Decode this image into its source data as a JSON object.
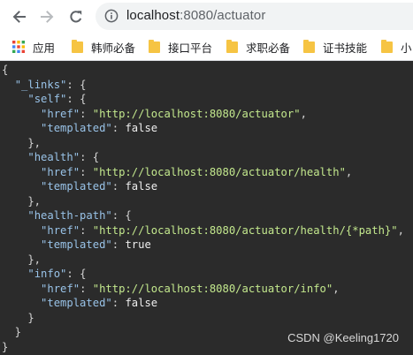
{
  "browser": {
    "url_host": "localhost",
    "url_rest": ":8080/actuator",
    "icons": [
      "back-arrow-icon",
      "forward-arrow-icon",
      "reload-icon",
      "info-icon"
    ]
  },
  "bookmarks": [
    {
      "label": "应用",
      "icon": "apps-grid-icon"
    },
    {
      "label": "韩师必备",
      "icon": "folder-icon"
    },
    {
      "label": "接口平台",
      "icon": "folder-icon"
    },
    {
      "label": "求职必备",
      "icon": "folder-icon"
    },
    {
      "label": "证书技能",
      "icon": "folder-icon"
    },
    {
      "label": "小",
      "icon": "folder-icon"
    }
  ],
  "json_view": {
    "lines": [
      [
        {
          "t": "punc",
          "v": "{"
        }
      ],
      [
        {
          "t": "punc",
          "v": "  "
        },
        {
          "t": "key",
          "v": "\"_links\""
        },
        {
          "t": "punc",
          "v": ": {"
        }
      ],
      [
        {
          "t": "punc",
          "v": "    "
        },
        {
          "t": "key",
          "v": "\"self\""
        },
        {
          "t": "punc",
          "v": ": {"
        }
      ],
      [
        {
          "t": "punc",
          "v": "      "
        },
        {
          "t": "key",
          "v": "\"href\""
        },
        {
          "t": "punc",
          "v": ": "
        },
        {
          "t": "str",
          "v": "\"http://localhost:8080/actuator\""
        },
        {
          "t": "punc",
          "v": ","
        }
      ],
      [
        {
          "t": "punc",
          "v": "      "
        },
        {
          "t": "key",
          "v": "\"templated\""
        },
        {
          "t": "punc",
          "v": ": "
        },
        {
          "t": "lit",
          "v": "false"
        }
      ],
      [
        {
          "t": "punc",
          "v": "    },"
        }
      ],
      [
        {
          "t": "punc",
          "v": "    "
        },
        {
          "t": "key",
          "v": "\"health\""
        },
        {
          "t": "punc",
          "v": ": {"
        }
      ],
      [
        {
          "t": "punc",
          "v": "      "
        },
        {
          "t": "key",
          "v": "\"href\""
        },
        {
          "t": "punc",
          "v": ": "
        },
        {
          "t": "str",
          "v": "\"http://localhost:8080/actuator/health\""
        },
        {
          "t": "punc",
          "v": ","
        }
      ],
      [
        {
          "t": "punc",
          "v": "      "
        },
        {
          "t": "key",
          "v": "\"templated\""
        },
        {
          "t": "punc",
          "v": ": "
        },
        {
          "t": "lit",
          "v": "false"
        }
      ],
      [
        {
          "t": "punc",
          "v": "    },"
        }
      ],
      [
        {
          "t": "punc",
          "v": "    "
        },
        {
          "t": "key",
          "v": "\"health-path\""
        },
        {
          "t": "punc",
          "v": ": {"
        }
      ],
      [
        {
          "t": "punc",
          "v": "      "
        },
        {
          "t": "key",
          "v": "\"href\""
        },
        {
          "t": "punc",
          "v": ": "
        },
        {
          "t": "str",
          "v": "\"http://localhost:8080/actuator/health/{*path}\""
        },
        {
          "t": "punc",
          "v": ","
        }
      ],
      [
        {
          "t": "punc",
          "v": "      "
        },
        {
          "t": "key",
          "v": "\"templated\""
        },
        {
          "t": "punc",
          "v": ": "
        },
        {
          "t": "lit",
          "v": "true"
        }
      ],
      [
        {
          "t": "punc",
          "v": "    },"
        }
      ],
      [
        {
          "t": "punc",
          "v": "    "
        },
        {
          "t": "key",
          "v": "\"info\""
        },
        {
          "t": "punc",
          "v": ": {"
        }
      ],
      [
        {
          "t": "punc",
          "v": "      "
        },
        {
          "t": "key",
          "v": "\"href\""
        },
        {
          "t": "punc",
          "v": ": "
        },
        {
          "t": "str",
          "v": "\"http://localhost:8080/actuator/info\""
        },
        {
          "t": "punc",
          "v": ","
        }
      ],
      [
        {
          "t": "punc",
          "v": "      "
        },
        {
          "t": "key",
          "v": "\"templated\""
        },
        {
          "t": "punc",
          "v": ": "
        },
        {
          "t": "lit",
          "v": "false"
        }
      ],
      [
        {
          "t": "punc",
          "v": "    }"
        }
      ],
      [
        {
          "t": "punc",
          "v": "  }"
        }
      ],
      [
        {
          "t": "punc",
          "v": "}"
        }
      ]
    ]
  },
  "watermark": "CSDN @Keeling1720",
  "colors": {
    "viewer_background": "#2b2b2b",
    "json_key": "#99c3e8",
    "json_string": "#c3e88d",
    "bookmark_folder": "#f6c443"
  }
}
